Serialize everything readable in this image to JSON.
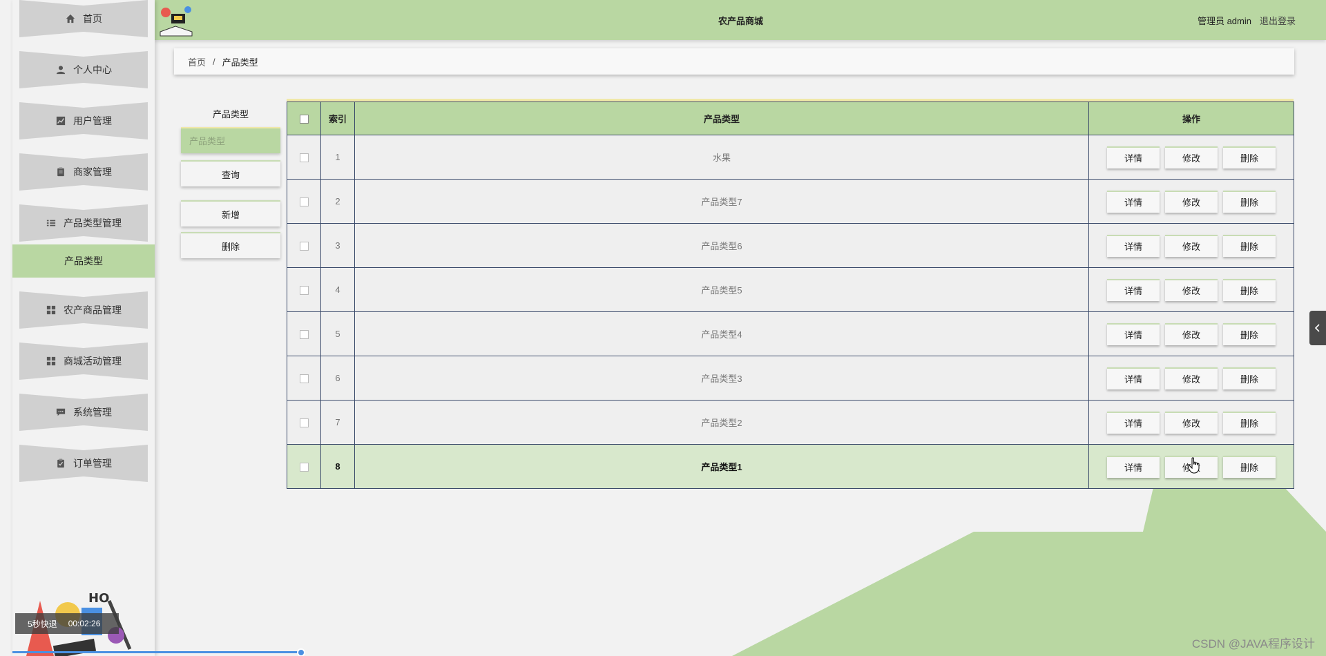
{
  "header": {
    "title": "农产品商城",
    "user_label": "管理员 admin",
    "logout_label": "退出登录"
  },
  "sidebar": {
    "items": [
      {
        "label": "首页",
        "icon": "home-icon"
      },
      {
        "label": "个人中心",
        "icon": "user-icon"
      },
      {
        "label": "用户管理",
        "icon": "chart-icon"
      },
      {
        "label": "商家管理",
        "icon": "clipboard-icon"
      },
      {
        "label": "产品类型管理",
        "icon": "list-icon"
      },
      {
        "label": "农产商品管理",
        "icon": "grid-icon"
      },
      {
        "label": "商城活动管理",
        "icon": "grid-icon"
      },
      {
        "label": "系统管理",
        "icon": "message-icon"
      },
      {
        "label": "订单管理",
        "icon": "clipboard-check-icon"
      }
    ],
    "active_sub": "产品类型"
  },
  "breadcrumb": {
    "home": "首页",
    "separator": "/",
    "current": "产品类型"
  },
  "search": {
    "label": "产品类型",
    "placeholder": "产品类型",
    "query_label": "查询",
    "add_label": "新增",
    "delete_label": "删除"
  },
  "table": {
    "headers": {
      "index": "索引",
      "type": "产品类型",
      "ops": "操作"
    },
    "rows": [
      {
        "index": "1",
        "type": "水果"
      },
      {
        "index": "2",
        "type": "产品类型7"
      },
      {
        "index": "3",
        "type": "产品类型6"
      },
      {
        "index": "4",
        "type": "产品类型5"
      },
      {
        "index": "5",
        "type": "产品类型4"
      },
      {
        "index": "6",
        "type": "产品类型3"
      },
      {
        "index": "7",
        "type": "产品类型2"
      },
      {
        "index": "8",
        "type": "产品类型1"
      }
    ],
    "actions": {
      "detail": "详情",
      "edit": "修改",
      "delete": "删除"
    }
  },
  "video": {
    "rewind_label": "5秒快退",
    "time": "00:02:26"
  },
  "watermark": "CSDN @JAVA程序设计",
  "colors": {
    "accent_green": "#b9d7a2",
    "menu_gray": "#d0d0d0",
    "highlight_row": "#d8e8cc",
    "header_border": "#f0e8a8"
  }
}
